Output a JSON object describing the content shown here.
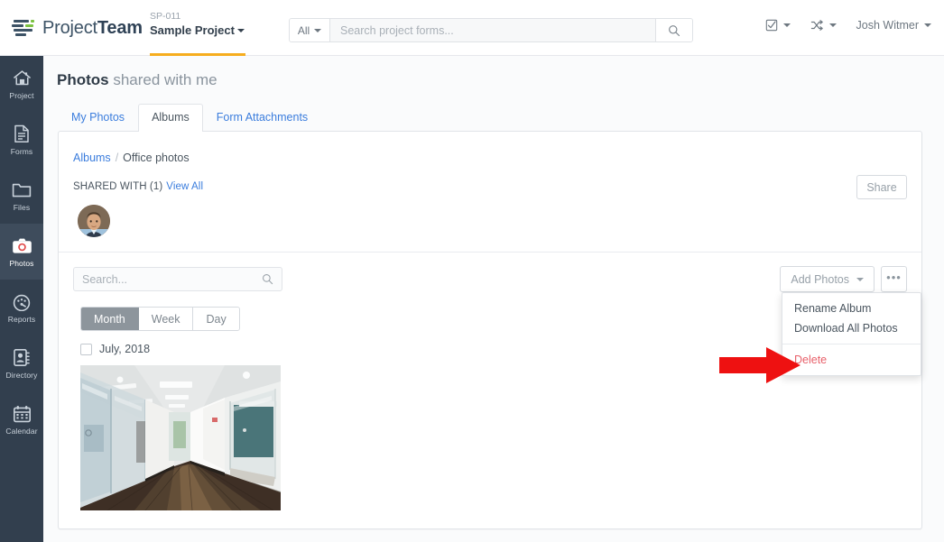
{
  "topbar": {
    "logo_text_light": "Project",
    "logo_text_bold": "Team",
    "logo_icon": "projectteam-logo-icon",
    "project_code": "SP-011",
    "project_name": "Sample Project",
    "search": {
      "scope_label": "All",
      "placeholder": "Search project forms...",
      "value": "",
      "search_icon": "search-icon"
    },
    "right_items": [
      {
        "name": "tasks-menu",
        "icon": "checkbox-checked-icon",
        "label": ""
      },
      {
        "name": "switch-menu",
        "icon": "shuffle-arrows-icon",
        "label": ""
      },
      {
        "name": "user-menu",
        "icon": "",
        "label": "Josh Witmer"
      }
    ]
  },
  "sidebar": {
    "items": [
      {
        "label": "Project",
        "icon": "home-icon",
        "active": false
      },
      {
        "label": "Forms",
        "icon": "document-icon",
        "active": false
      },
      {
        "label": "Files",
        "icon": "folder-icon",
        "active": false
      },
      {
        "label": "Photos",
        "icon": "camera-icon",
        "active": true
      },
      {
        "label": "Reports",
        "icon": "gauge-icon",
        "active": false
      },
      {
        "label": "Directory",
        "icon": "contacts-icon",
        "active": false
      },
      {
        "label": "Calendar",
        "icon": "calendar-icon",
        "active": false
      }
    ]
  },
  "page": {
    "title_bold": "Photos",
    "title_rest": "shared with me",
    "tabs": [
      {
        "label": "My Photos",
        "active": false
      },
      {
        "label": "Albums",
        "active": true
      },
      {
        "label": "Form Attachments",
        "active": false
      }
    ]
  },
  "album": {
    "breadcrumb_root": "Albums",
    "breadcrumb_sep": "/",
    "breadcrumb_current": "Office photos",
    "shared_with_label": "SHARED WITH (1)",
    "view_all_label": "View All",
    "share_button": "Share",
    "avatar_name": "shared-user-avatar",
    "search": {
      "placeholder": "Search...",
      "value": "",
      "search_icon": "search-icon"
    },
    "add_photos_label": "Add Photos",
    "more_menu_icon": "ellipsis-icon",
    "menu": {
      "items": [
        {
          "label": "Rename Album",
          "danger": false
        },
        {
          "label": "Download All Photos",
          "danger": false
        }
      ],
      "danger_item": {
        "label": "Delete",
        "danger": true
      }
    },
    "view_modes": [
      {
        "label": "Month",
        "active": true
      },
      {
        "label": "Week",
        "active": false
      },
      {
        "label": "Day",
        "active": false
      }
    ],
    "group_label": "July, 2018",
    "group_checked": false,
    "photo_alt": "office-corridor-photo"
  },
  "annotation": {
    "arrow_name": "red-pointer-arrow",
    "arrow_color": "#ee1111",
    "points_at": "Delete"
  },
  "colors": {
    "accent_blue": "#3b7ddd",
    "brand_navy": "#323f4e",
    "project_underline": "#f6ad1e",
    "danger_red": "#e8606a",
    "logo_green": "#7cc242"
  }
}
